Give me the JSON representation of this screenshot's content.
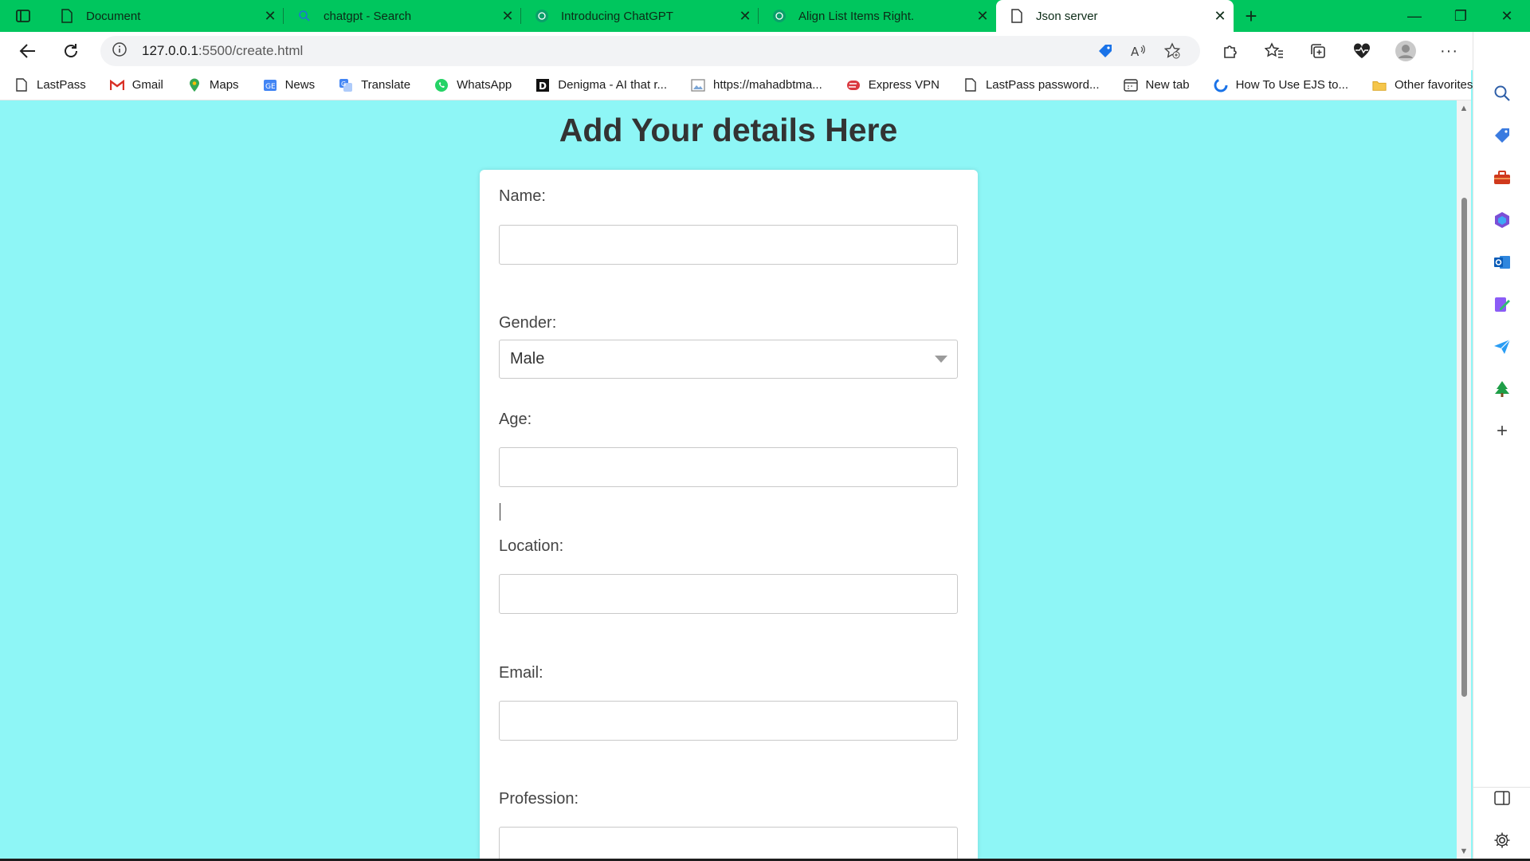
{
  "tabs": [
    {
      "title": "Document",
      "icon": "document-icon",
      "active": false
    },
    {
      "title": "chatgpt - Search",
      "icon": "search-icon",
      "active": false
    },
    {
      "title": "Introducing ChatGPT",
      "icon": "chatgpt-icon",
      "active": false
    },
    {
      "title": "Align List Items Right.",
      "icon": "chatgpt-icon",
      "active": false
    },
    {
      "title": "Json server",
      "icon": "document-icon",
      "active": true
    }
  ],
  "address": {
    "host": "127.0.0.1",
    "path": ":5500/create.html"
  },
  "bookmarks": [
    {
      "label": "LastPass",
      "icon": "document-icon"
    },
    {
      "label": "Gmail",
      "icon": "gmail-icon"
    },
    {
      "label": "Maps",
      "icon": "maps-pin-icon"
    },
    {
      "label": "News",
      "icon": "news-icon"
    },
    {
      "label": "Translate",
      "icon": "translate-icon"
    },
    {
      "label": "WhatsApp",
      "icon": "whatsapp-icon"
    },
    {
      "label": "Denigma - AI that r...",
      "icon": "denigma-icon"
    },
    {
      "label": "https://mahadbtma...",
      "icon": "image-icon"
    },
    {
      "label": "Express VPN",
      "icon": "expressvpn-icon"
    },
    {
      "label": "LastPass password...",
      "icon": "document-icon"
    },
    {
      "label": "New tab",
      "icon": "newtab-icon"
    },
    {
      "label": "How To Use EJS to...",
      "icon": "ejs-icon"
    }
  ],
  "other_favorites": "Other favorites",
  "page": {
    "title": "Add Your details Here",
    "form": {
      "name_label": "Name:",
      "gender_label": "Gender:",
      "gender_value": "Male",
      "age_label": "Age:",
      "location_label": "Location:",
      "email_label": "Email:",
      "profession_label": "Profession:"
    }
  },
  "colors": {
    "tabstrip": "#00c65e",
    "page_background": "#8ef6f6",
    "card": "#ffffff"
  }
}
